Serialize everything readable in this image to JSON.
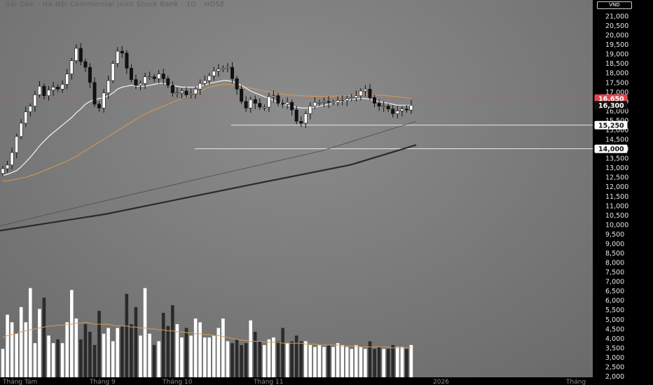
{
  "title": "Sài Gòn - Hà Nội Commercial Joint Stock Bank · 1D · HOSE",
  "currency": "VND",
  "colors": {
    "candle": "#ffffff",
    "candle_down": "#111111",
    "ma_fast": "#f4f4f4",
    "ma_mid": "#d79a52",
    "ma_slow": "#555555",
    "ma_long": "#2a2a2a",
    "hline": "#e9e9e9",
    "price_badge_current": "#e0474c",
    "vol_up": "#ffffff",
    "vol_down": "#2a2a2a",
    "vol_ma": "#d79a52"
  },
  "chart_data": {
    "type": "candlestick",
    "title": "Sài Gòn - Hà Nội Commercial Joint Stock Bank · 1D · HOSE",
    "y_axis": {
      "unit": "VND",
      "range": [
        2000,
        21500
      ],
      "ticks": [
        "2,000",
        "2,500",
        "3,000",
        "3,500",
        "4,000",
        "4,500",
        "5,000",
        "5,500",
        "6,000",
        "6,500",
        "7,000",
        "7,500",
        "8,000",
        "8,500",
        "9,000",
        "9,500",
        "10,000",
        "10,500",
        "11,000",
        "11,500",
        "12,000",
        "12,500",
        "13,000",
        "13,500",
        "14,000",
        "14,500",
        "15,000",
        "15,500",
        "16,000",
        "16,500",
        "17,000",
        "17,500",
        "18,000",
        "18,500",
        "19,000",
        "19,500",
        "20,000",
        "20,500",
        "21,000"
      ]
    },
    "x_axis": {
      "labels": [
        "Tháng Tám",
        "Tháng 9",
        "Tháng 10",
        "Tháng 11",
        "2026",
        "Tháng"
      ]
    },
    "price_labels": [
      {
        "value": "16,650",
        "kind": "current"
      },
      {
        "value": "16,300",
        "kind": "ma"
      },
      {
        "value": "15,250",
        "kind": "level"
      },
      {
        "value": "14,000",
        "kind": "level"
      }
    ],
    "horizontal_levels": [
      15250,
      14000
    ],
    "close": [
      12950,
      13150,
      13800,
      14650,
      15350,
      15950,
      16250,
      16850,
      17300,
      16800,
      17100,
      17250,
      17150,
      17400,
      17950,
      18650,
      19300,
      18600,
      18300,
      17500,
      16350,
      16150,
      16950,
      17600,
      18500,
      19150,
      19050,
      18250,
      17650,
      17350,
      17450,
      17800,
      17800,
      17700,
      17950,
      17700,
      17350,
      16950,
      16950,
      17050,
      16850,
      16900,
      17150,
      17450,
      17600,
      17850,
      18100,
      18200,
      18250,
      18300,
      17700,
      17150,
      16500,
      16150,
      16600,
      16400,
      16200,
      16200,
      16750,
      16800,
      16400,
      16350,
      16450,
      16050,
      15450,
      15350,
      15850,
      16250,
      16450,
      16450,
      16500,
      16450,
      16450,
      16550,
      16550,
      16650,
      16700,
      16800,
      17050,
      17150,
      16700,
      16400,
      16250,
      16250,
      16100,
      15850,
      16000,
      16100,
      16050,
      16300
    ],
    "ma_fast": [
      12600,
      12650,
      12750,
      12850,
      13050,
      13300,
      13550,
      13850,
      14150,
      14400,
      14650,
      14850,
      15050,
      15250,
      15450,
      15650,
      15900,
      16100,
      16350,
      16500,
      16600,
      16650,
      16700,
      16800,
      16950,
      17150,
      17250,
      17300,
      17350,
      17300,
      17300,
      17300,
      17350,
      17400,
      17450,
      17450,
      17400,
      17350,
      17300,
      17250,
      17250,
      17250,
      17250,
      17300,
      17350,
      17450,
      17500,
      17550,
      17600,
      17600,
      17550,
      17450,
      17350,
      17200,
      17050,
      16950,
      16850,
      16750,
      16650,
      16550,
      16450,
      16350,
      16300,
      16250,
      16200,
      16150,
      16150,
      16150,
      16200,
      16250,
      16300,
      16350,
      16400,
      16450,
      16500,
      16550,
      16600,
      16650,
      16650,
      16650,
      16600,
      16550,
      16500,
      16450,
      16400,
      16350,
      16300,
      16300,
      16300,
      16300
    ],
    "ma_mid": [
      12300,
      12320,
      12350,
      12400,
      12450,
      12500,
      12580,
      12650,
      12750,
      12850,
      12950,
      13050,
      13150,
      13250,
      13350,
      13480,
      13600,
      13750,
      13900,
      14050,
      14200,
      14350,
      14500,
      14650,
      14800,
      14950,
      15100,
      15250,
      15400,
      15550,
      15700,
      15850,
      15950,
      16050,
      16150,
      16250,
      16350,
      16450,
      16550,
      16650,
      16750,
      16850,
      16950,
      17050,
      17150,
      17250,
      17300,
      17350,
      17400,
      17400,
      17380,
      17340,
      17300,
      17250,
      17200,
      17150,
      17100,
      17050,
      17000,
      16950,
      16900,
      16870,
      16850,
      16830,
      16810,
      16800,
      16790,
      16780,
      16770,
      16770,
      16770,
      16770,
      16780,
      16790,
      16800,
      16810,
      16820,
      16830,
      16840,
      16850,
      16850,
      16840,
      16830,
      16810,
      16790,
      16770,
      16740,
      16710,
      16680,
      16650
    ],
    "ma_slow": [
      [
        0,
        9930
      ],
      [
        120,
        11000
      ],
      [
        300,
        12550
      ],
      [
        460,
        13900
      ],
      [
        594,
        15450
      ]
    ],
    "ma_long": [
      [
        0,
        9680
      ],
      [
        150,
        10550
      ],
      [
        350,
        12050
      ],
      [
        500,
        13150
      ],
      [
        594,
        14200
      ]
    ],
    "volume": [
      3500,
      5300,
      4900,
      4300,
      5700,
      4900,
      6700,
      3800,
      5600,
      6200,
      4200,
      3800,
      4000,
      3800,
      4900,
      6600,
      5100,
      4000,
      4800,
      4400,
      3700,
      5500,
      4300,
      4600,
      3900,
      4600,
      4700,
      6400,
      4800,
      5700,
      4200,
      6700,
      4300,
      3700,
      3900,
      5400,
      4700,
      5800,
      4800,
      4100,
      4600,
      4200,
      5100,
      4900,
      4100,
      4100,
      4200,
      4600,
      5100,
      3900,
      3800,
      4000,
      3700,
      3800,
      5000,
      4400,
      3900,
      3700,
      4000,
      4100,
      3900,
      4600,
      3800,
      3900,
      4200,
      3900,
      3900,
      3700,
      3600,
      3700,
      3600,
      3700,
      3600,
      3800,
      3700,
      3600,
      3500,
      3700,
      3600,
      3500,
      3900,
      3500,
      3600,
      3500,
      3500,
      3700,
      3600,
      3600,
      3500,
      3700
    ],
    "volume_ma": [
      4100,
      4200,
      4250,
      4300,
      4400,
      4450,
      4500,
      4550,
      4600,
      4650,
      4700,
      4700,
      4750,
      4750,
      4800,
      4800,
      4850,
      4850,
      4900,
      4850,
      4800,
      4800,
      4800,
      4800,
      4750,
      4700,
      4700,
      4700,
      4650,
      4650,
      4600,
      4600,
      4550,
      4550,
      4500,
      4500,
      4450,
      4450,
      4400,
      4400,
      4350,
      4350,
      4300,
      4300,
      4250,
      4250,
      4200,
      4200,
      4150,
      4100,
      4050,
      4000,
      3950,
      3950,
      3900,
      3900,
      3900,
      3850,
      3850,
      3850,
      3850,
      3800,
      3800,
      3800,
      3800,
      3800,
      3750,
      3750,
      3750,
      3700,
      3700,
      3700,
      3700,
      3700,
      3650,
      3650,
      3650,
      3650,
      3600,
      3600,
      3600,
      3600,
      3600,
      3600,
      3600,
      3550,
      3550,
      3550,
      3550,
      3550
    ]
  }
}
